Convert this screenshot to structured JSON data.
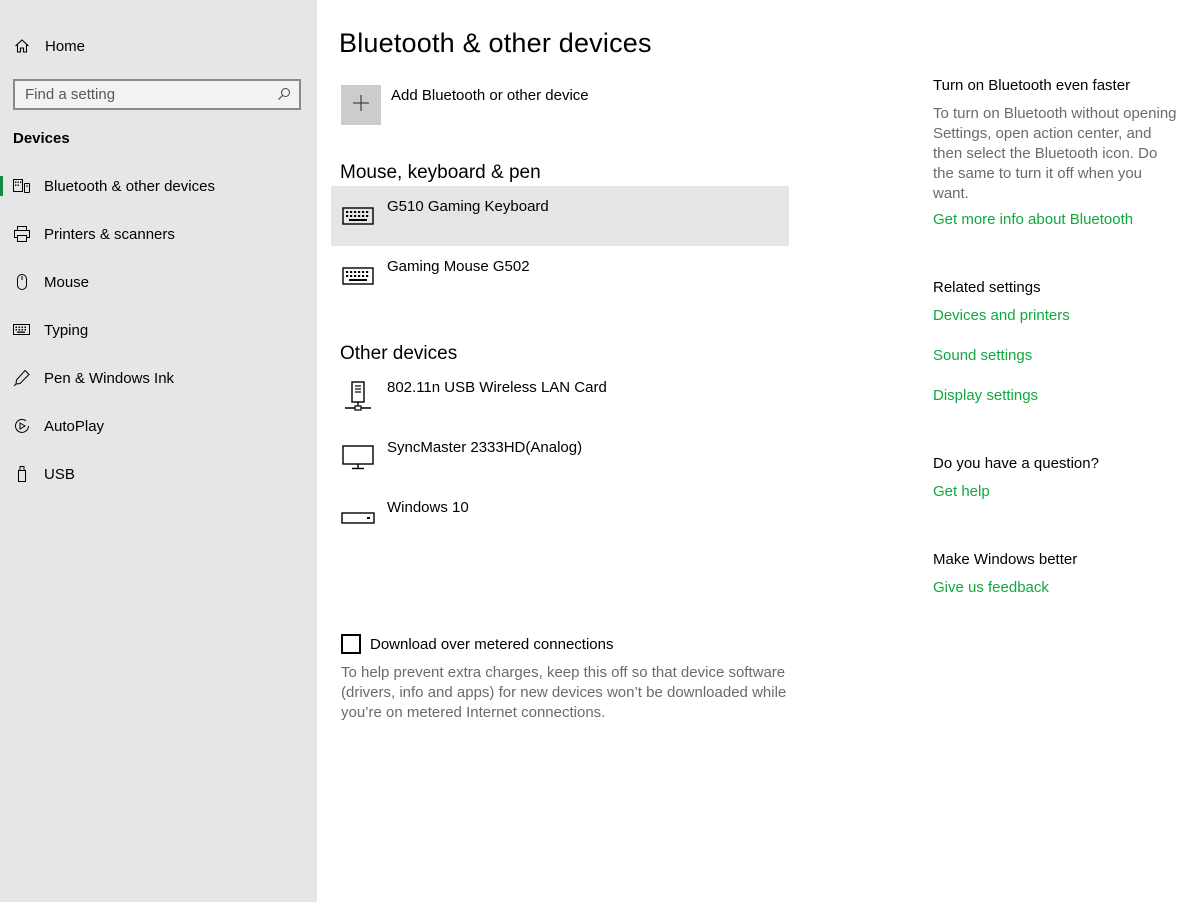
{
  "sidebar": {
    "home_label": "Home",
    "search_placeholder": "Find a setting",
    "section_title": "Devices",
    "items": [
      {
        "label": "Bluetooth & other devices",
        "icon": "bluetooth-devices-icon",
        "active": true
      },
      {
        "label": "Printers & scanners",
        "icon": "printer-icon"
      },
      {
        "label": "Mouse",
        "icon": "mouse-icon"
      },
      {
        "label": "Typing",
        "icon": "keyboard-icon"
      },
      {
        "label": "Pen & Windows Ink",
        "icon": "pen-icon"
      },
      {
        "label": "AutoPlay",
        "icon": "autoplay-icon"
      },
      {
        "label": "USB",
        "icon": "usb-icon"
      }
    ]
  },
  "main": {
    "title": "Bluetooth & other devices",
    "add_device_label": "Add Bluetooth or other device",
    "groups": [
      {
        "title": "Mouse, keyboard & pen",
        "devices": [
          {
            "name": "G510 Gaming Keyboard",
            "icon": "keyboard-icon",
            "selected": true
          },
          {
            "name": "Gaming Mouse G502",
            "icon": "keyboard-icon"
          }
        ]
      },
      {
        "title": "Other devices",
        "devices": [
          {
            "name": "802.11n USB Wireless LAN Card",
            "icon": "network-adapter-icon"
          },
          {
            "name": "SyncMaster 2333HD(Analog)",
            "icon": "monitor-icon"
          },
          {
            "name": "Windows 10",
            "icon": "computer-box-icon"
          }
        ]
      }
    ],
    "metered_label": "Download over metered connections",
    "metered_checked": false,
    "metered_description": "To help prevent extra charges, keep this off so that device software (drivers, info and apps) for new devices won’t be downloaded while you’re on metered Internet connections."
  },
  "right": {
    "bt_heading": "Turn on Bluetooth even faster",
    "bt_text": "To turn on Bluetooth without opening Settings, open action center, and then select the Bluetooth icon. Do the same to turn it off when you want.",
    "bt_link": "Get more info about Bluetooth",
    "related_heading": "Related settings",
    "related_links": [
      "Devices and printers",
      "Sound settings",
      "Display settings"
    ],
    "question_heading": "Do you have a question?",
    "help_link": "Get help",
    "better_heading": "Make Windows better",
    "feedback_link": "Give us feedback"
  },
  "colors": {
    "accent": "#10893e",
    "link": "#10a83e",
    "sidebar_bg": "#e6e6e6",
    "selected_bg": "#e5e5e5",
    "secondary_text": "#6b6b6b"
  }
}
